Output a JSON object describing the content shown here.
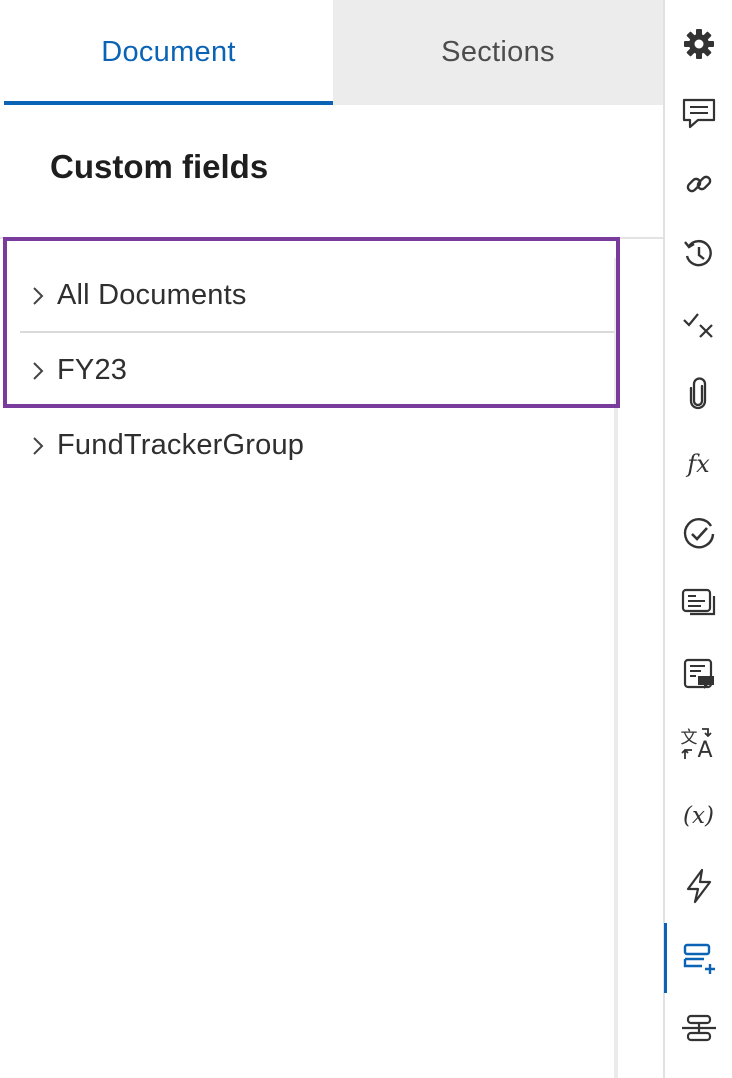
{
  "tabs": {
    "document": "Document",
    "sections": "Sections"
  },
  "panel": {
    "heading": "Custom fields"
  },
  "tree": {
    "items": [
      {
        "label": "All Documents"
      },
      {
        "label": "FY23"
      },
      {
        "label": "FundTrackerGroup"
      }
    ]
  },
  "rail": {
    "icons": [
      "gear-icon",
      "comments-icon",
      "link-icon",
      "history-icon",
      "check-x-icon",
      "paperclip-icon",
      "formula-icon",
      "check-circle-icon",
      "notes-icon",
      "annotation-icon",
      "translate-icon",
      "variable-icon",
      "lightning-icon",
      "custom-fields-icon",
      "connect-icon"
    ],
    "active": "custom-fields-icon",
    "formula_glyph": "fx",
    "variable_glyph": "(x)",
    "translate_top": "文",
    "translate_bottom": "A"
  },
  "colors": {
    "accent": "#0b63b5",
    "highlight": "#7a3c9c",
    "tab_inactive_bg": "#ececec"
  }
}
